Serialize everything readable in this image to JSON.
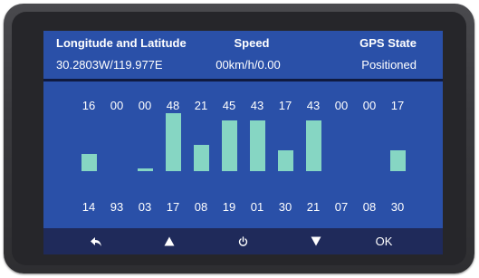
{
  "header": {
    "longitude_label": "Longitude and Latitude",
    "longitude_value": "30.2803W/119.977E",
    "speed_label": "Speed",
    "speed_value": "00km/h/0.00",
    "gps_label": "GPS State",
    "gps_value": "Positioned"
  },
  "satellites": [
    {
      "signal": "16",
      "id": "14",
      "level": 0.3
    },
    {
      "signal": "00",
      "id": "93",
      "level": 0.0
    },
    {
      "signal": "00",
      "id": "03",
      "level": 0.04
    },
    {
      "signal": "48",
      "id": "17",
      "level": 1.0
    },
    {
      "signal": "21",
      "id": "08",
      "level": 0.45
    },
    {
      "signal": "45",
      "id": "19",
      "level": 0.88
    },
    {
      "signal": "43",
      "id": "01",
      "level": 0.88
    },
    {
      "signal": "17",
      "id": "30",
      "level": 0.36
    },
    {
      "signal": "43",
      "id": "21",
      "level": 0.88
    },
    {
      "signal": "00",
      "id": "07",
      "level": 0.0
    },
    {
      "signal": "00",
      "id": "08",
      "level": 0.0
    },
    {
      "signal": "17",
      "id": "30",
      "level": 0.36
    }
  ],
  "footer": {
    "back_icon": "back-arrow-icon",
    "up_icon": "triangle-up-icon",
    "power_icon": "power-icon",
    "down_icon": "triangle-down-icon",
    "ok_label": "OK"
  },
  "colors": {
    "panel_blue": "#2a50a8",
    "bar_teal": "#86d6c3",
    "footer_navy": "#1f2a5a"
  }
}
